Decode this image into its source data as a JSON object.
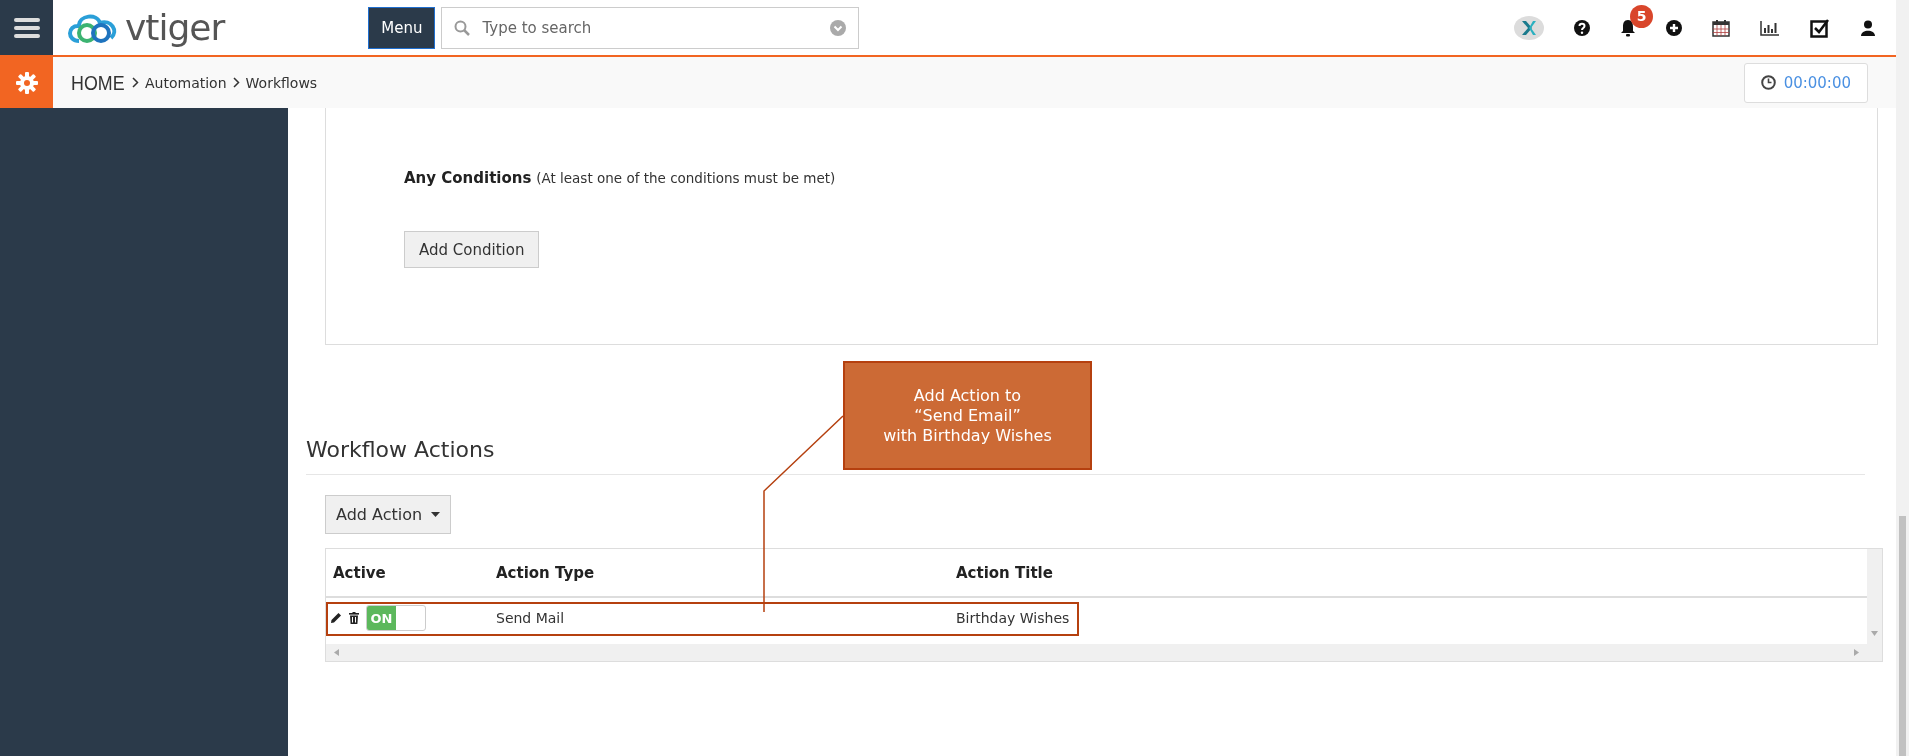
{
  "topbar": {
    "logo": "vtiger",
    "menu_button": "Menu",
    "search": {
      "placeholder": "Type to search"
    },
    "notification_count": "5"
  },
  "breadcrumb": [
    "HOME",
    "Automation",
    "Workflows"
  ],
  "timer": "00:00:00",
  "conditions": {
    "title": "Any Conditions",
    "note": "(At least one of the conditions must be met)",
    "button": "Add Condition"
  },
  "workflow_actions": {
    "title": "Workflow Actions",
    "add_button": "Add Action",
    "columns": [
      "Active",
      "Action Type",
      "Action Title"
    ],
    "rows": [
      {
        "active": true,
        "switch_label": "ON",
        "action_type": "Send Mail",
        "action_title": "Birthday Wishes",
        "highlighted": true
      }
    ]
  },
  "callout": {
    "lines": [
      "Add Action to",
      "“Send Email”",
      "with Birthday Wishes"
    ]
  }
}
